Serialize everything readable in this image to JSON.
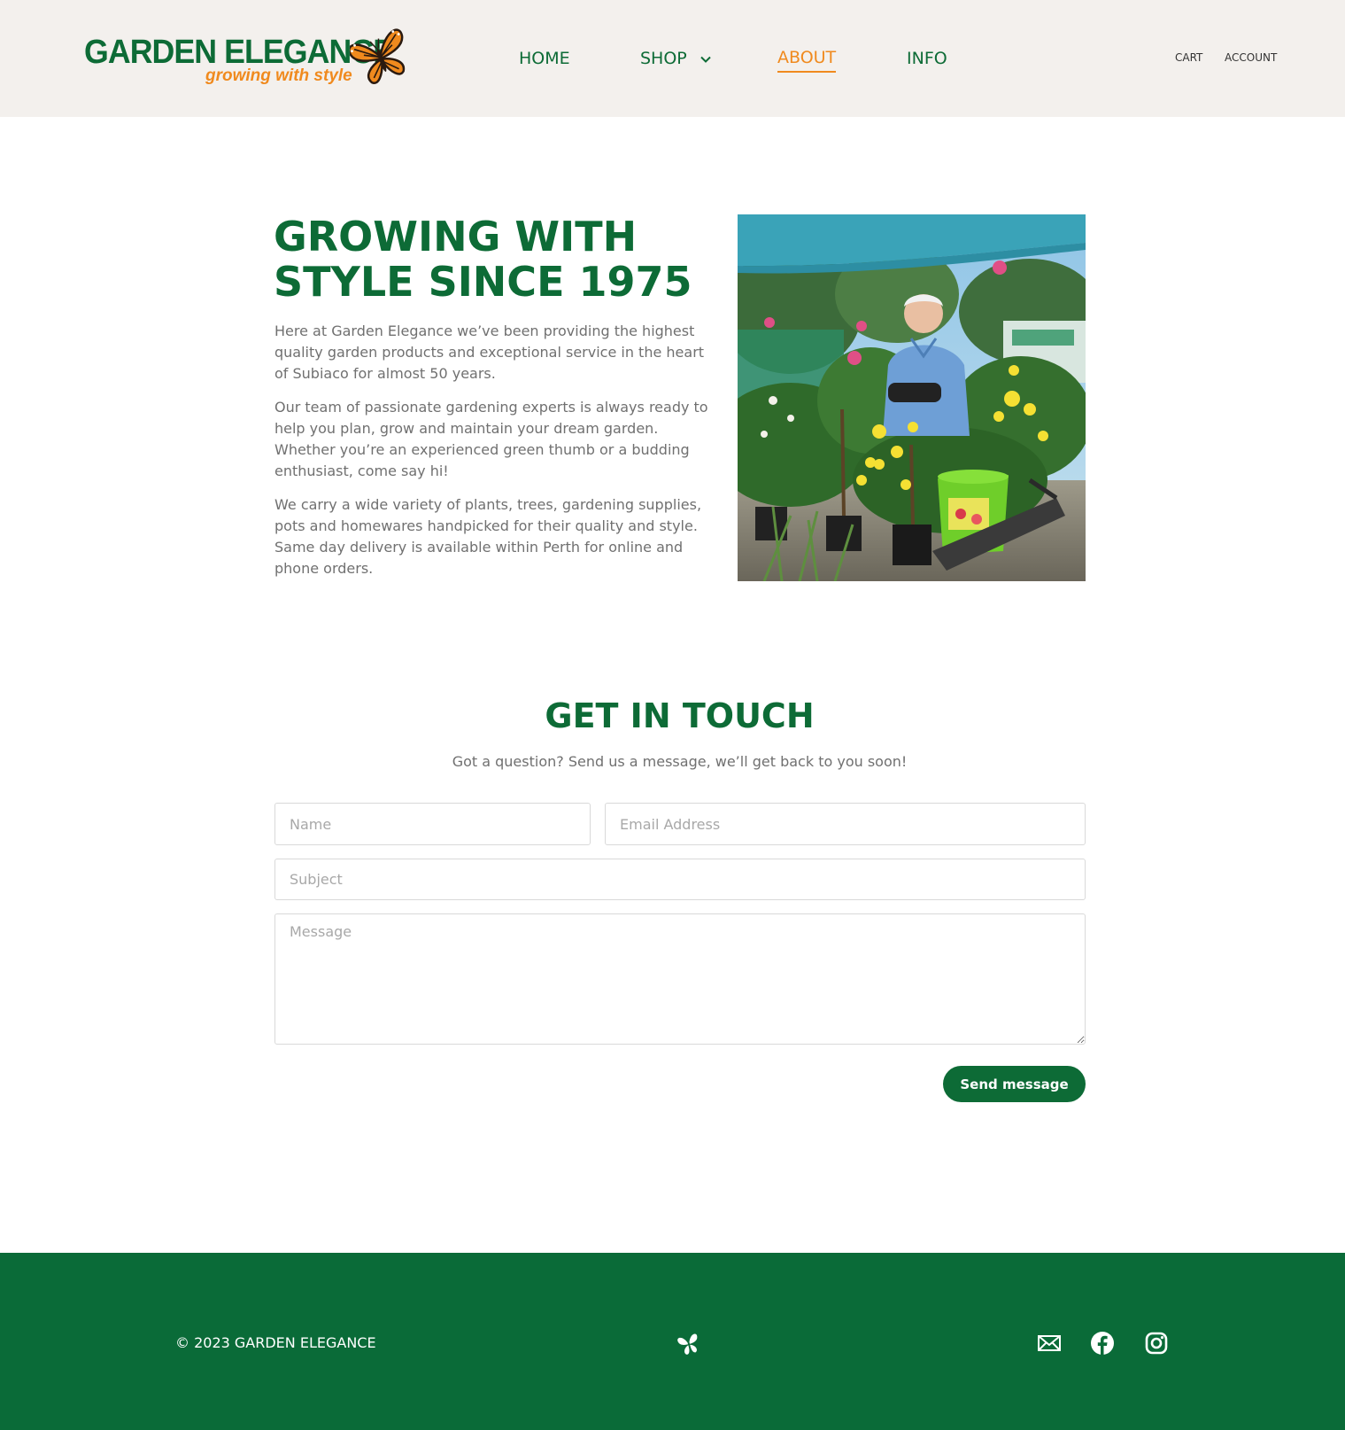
{
  "brand": {
    "name": "GARDEN ELEGANCE",
    "tagline": "growing with style",
    "primary_color": "#0d6b36",
    "accent_color": "#f08a1e",
    "logo_icon": "butterfly-icon"
  },
  "nav": {
    "items": [
      {
        "label": "HOME",
        "active": false
      },
      {
        "label": "SHOP",
        "active": false,
        "has_dropdown": true
      },
      {
        "label": "ABOUT",
        "active": true
      },
      {
        "label": "INFO",
        "active": false
      }
    ],
    "cart_label": "CART",
    "account_label": "ACCOUNT"
  },
  "about": {
    "title": "GROWING WITH\nSTYLE SINCE 1975",
    "paragraphs": [
      "Here at Garden Elegance we’ve been providing the highest quality garden products and exceptional service in the heart of Subiaco for almost 50 years.",
      "Our team of passionate gardening experts is always ready to help you plan, grow and maintain your dream garden. Whether you’re an experienced green thumb or a budding enthusiast, come say hi!",
      "We carry a wide variety of plants, trees, gardening supplies, pots and homewares handpicked for their quality and style. Same day delivery is available within Perth for online and phone orders."
    ]
  },
  "contact": {
    "title": "GET IN TOUCH",
    "subtitle": "Got a question? Send us a message, we’ll get back to you soon!",
    "name_placeholder": "Name",
    "email_placeholder": "Email Address",
    "subject_placeholder": "Subject",
    "message_placeholder": "Message",
    "send_label": "Send message"
  },
  "footer": {
    "copyright": "© 2023 GARDEN ELEGANCE",
    "icons": [
      "mail-icon",
      "facebook-icon",
      "instagram-icon"
    ],
    "background": "#0a6b38"
  }
}
